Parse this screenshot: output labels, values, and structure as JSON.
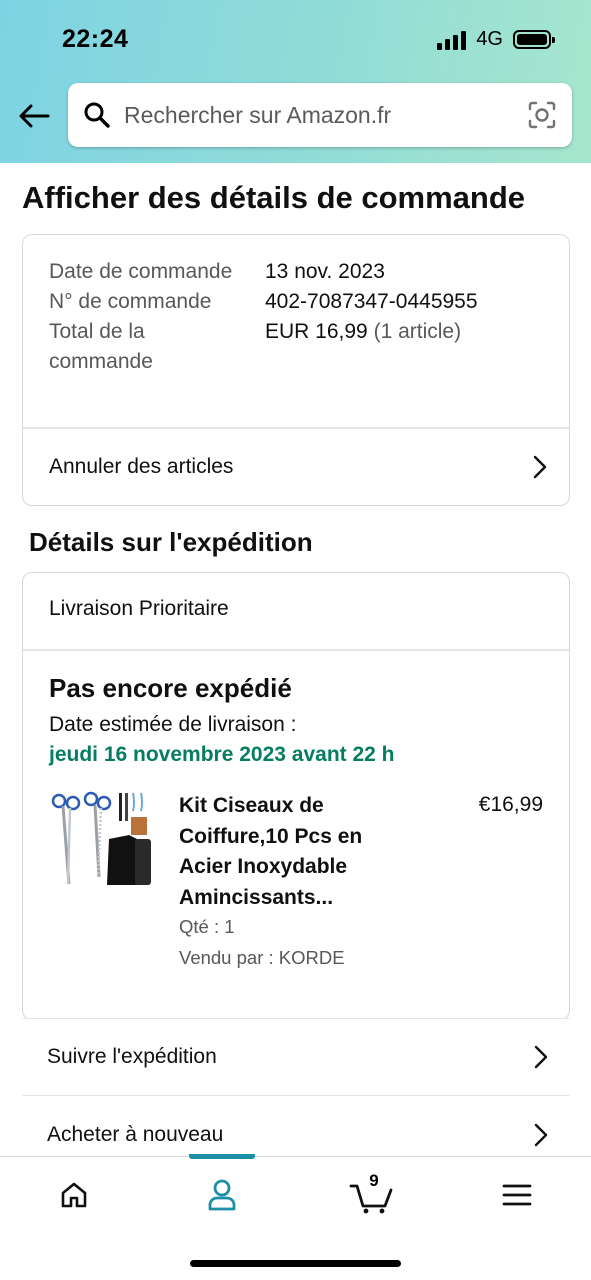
{
  "status_bar": {
    "time": "22:24",
    "network": "4G"
  },
  "search": {
    "placeholder": "Rechercher sur Amazon.fr"
  },
  "page": {
    "title": "Afficher des détails de commande"
  },
  "order_summary": {
    "date_label": "Date de commande",
    "date_value": "13 nov. 2023",
    "number_label": "N° de commande",
    "number_value": "402-7087347-0445955",
    "total_label": "Total de la commande",
    "total_value": "EUR 16,99",
    "total_items": "(1 article)",
    "cancel_link": "Annuler des articles"
  },
  "shipping": {
    "section_title": "Détails sur l'expédition",
    "method": "Livraison Prioritaire",
    "status": "Pas encore expédié",
    "estimated_label": "Date estimée de livraison :",
    "estimated_date": "jeudi 16 novembre 2023 avant 22 h",
    "product": {
      "title": "Kit Ciseaux de Coiffure,10 Pcs en Acier Inoxydable Amincissants...",
      "price": "€16,99",
      "quantity": "Qté : 1",
      "seller": "Vendu par : KORDE"
    }
  },
  "actions": {
    "track": "Suivre l'expédition",
    "buy_again": "Acheter à nouveau"
  },
  "bottom_nav": {
    "cart_count": "9",
    "active_tab": "account",
    "accent_color": "#1b8fa6"
  },
  "colors": {
    "delivery_green": "#067d62",
    "header_gradient_start": "#7ed3e3",
    "header_gradient_end": "#a6e6cd"
  }
}
